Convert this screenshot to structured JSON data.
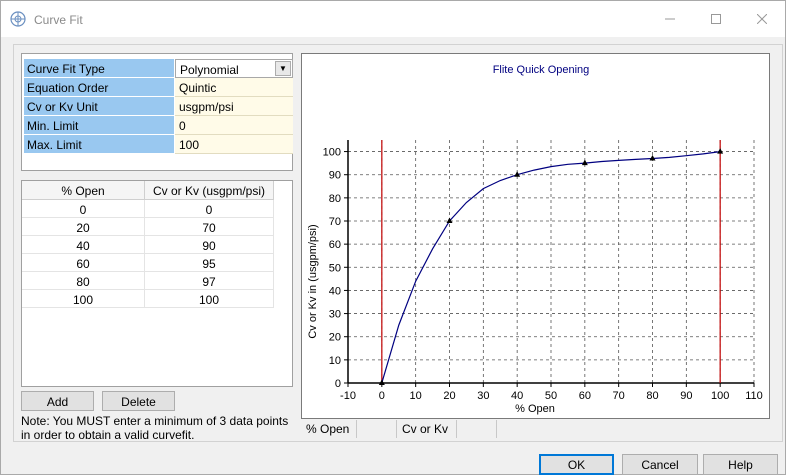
{
  "window": {
    "title": "Curve Fit"
  },
  "properties": [
    {
      "name": "Curve Fit Type",
      "value": "Polynomial",
      "control": "dropdown"
    },
    {
      "name": "Equation Order",
      "value": "Quintic"
    },
    {
      "name": "Cv or Kv Unit",
      "value": "usgpm/psi"
    },
    {
      "name": "Min. Limit",
      "value": "0"
    },
    {
      "name": "Max. Limit",
      "value": "100"
    }
  ],
  "table": {
    "headers": [
      "% Open",
      "Cv or Kv (usgpm/psi)"
    ],
    "rows": [
      [
        "0",
        "0"
      ],
      [
        "20",
        "70"
      ],
      [
        "40",
        "90"
      ],
      [
        "60",
        "95"
      ],
      [
        "80",
        "97"
      ],
      [
        "100",
        "100"
      ]
    ]
  },
  "buttons": {
    "add": "Add",
    "delete": "Delete",
    "ok": "OK",
    "cancel": "Cancel",
    "help": "Help"
  },
  "note": "Note: You MUST enter a minimum of 3 data points in order to obtain a valid curvefit.",
  "legend": {
    "col1": "% Open",
    "col2": "Cv or Kv"
  },
  "colors": {
    "curve": "#000080",
    "limit_lines": "#c00000",
    "title": "#000080",
    "grid": "#555555",
    "property_name_bg": "#99c8f0",
    "property_value_bg": "#fffbe8"
  },
  "chart_data": {
    "type": "line",
    "title": "Flite Quick Opening",
    "xlabel": "% Open",
    "ylabel": "Cv or Kv in (usgpm/psi)",
    "xlim": [
      -10,
      110
    ],
    "ylim": [
      0,
      105
    ],
    "x_ticks": [
      -10,
      0,
      10,
      20,
      30,
      40,
      50,
      60,
      70,
      80,
      90,
      100,
      110
    ],
    "y_ticks": [
      0,
      10,
      20,
      30,
      40,
      50,
      60,
      70,
      80,
      90,
      100
    ],
    "grid": true,
    "vertical_limit_lines": [
      0,
      100
    ],
    "points": {
      "x": [
        0,
        20,
        40,
        60,
        80,
        100
      ],
      "y": [
        0,
        70,
        90,
        95,
        97,
        100
      ]
    },
    "fitted_curve": {
      "x": [
        0,
        5,
        10,
        15,
        20,
        25,
        30,
        35,
        40,
        45,
        50,
        55,
        60,
        65,
        70,
        75,
        80,
        85,
        90,
        95,
        100
      ],
      "y": [
        0,
        25,
        44,
        58,
        70,
        78,
        84,
        87.5,
        90,
        92,
        93.5,
        94.5,
        95,
        95.7,
        96.2,
        96.6,
        97,
        97.5,
        98.2,
        99,
        100
      ]
    }
  }
}
